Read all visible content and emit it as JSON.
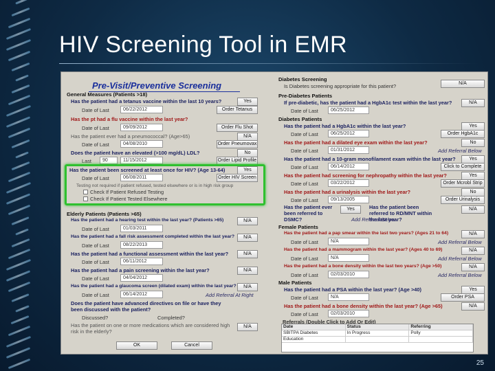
{
  "slide": {
    "title": "HIV Screening Tool in EMR",
    "number": "25"
  },
  "emr": {
    "panel_title": "Pre-Visit/Preventive Screening",
    "general": {
      "header": "General Measures (Patients >18)",
      "tetanus_q": "Has the patient had a tetanus vaccine within the last 10 years?",
      "tetanus_ans": "Yes",
      "date_of_last": "Date of Last",
      "tetanus_date": "06/22/2012",
      "order_tetanus": "Order Tetanus",
      "flu_q": "Has the pt had a flu vaccine within the last year?",
      "flu_date": "09/09/2012",
      "order_flu": "Order Flu Shot",
      "pneumo_q": "Has the patient ever had a pneumococcal? (Age>65)",
      "pneumo_ans": "N/A",
      "pneumo_date": "04/08/2010",
      "order_pneumovax": "Order Pneumovax",
      "ldl_q": "Does the patient have an elevated (>100 mg/dL) LDL?",
      "ldl_ans": "No",
      "ldl_last": "Last",
      "ldl_value": "90",
      "ldl_date": "11/15/2012",
      "order_lipid": "Order Lipid Profile",
      "hiv_q": "Has the patient been screened at least once for HIV? (Age 13-64)",
      "hiv_ans": "Yes",
      "hiv_date": "06/08/2011",
      "order_hiv": "Order HIV Screen",
      "hiv_note": "Testing not required if patient refused, tested elsewhere or is in high risk group",
      "check_refused": "Check If Patient Refused Testing",
      "check_elsewhere": "Check If Patient Tested Elsewhere"
    },
    "elderly": {
      "header": "Elderly Patients (Patients >65)",
      "hearing_q": "Has the patient had a hearing test within the last year? (Patients >65)",
      "hearing_ans": "N/A",
      "hearing_date": "01/03/2011",
      "fall_q": "Has the patient had a fall risk assessment completed within the last year?",
      "fall_ans": "N/A",
      "fall_date": "08/22/2013",
      "functional_q": "Has the patient had a functional assessment within the last year?",
      "functional_ans": "N/A",
      "functional_date": "06/11/2012",
      "pain_q": "Has the patient had a pain screening within the last year?",
      "pain_ans": "N/A",
      "pain_date": "04/04/2012",
      "glaucoma_q": "Has the patient had a glaucoma screen (dilated exam) within the last year?",
      "glaucoma_ans": "N/A",
      "glaucoma_date": "06/14/2012",
      "add_referral_right": "Add Referral At Right",
      "advance_q": "Does the patient have advanced directives on file or have they been discussed with the patient?",
      "discussed": "Discussed?",
      "completed": "Completed?",
      "meds_q": "Has the patient on one or more medications which are considered high risk in the elderly?",
      "meds_ans": "N/A",
      "ok": "OK",
      "cancel": "Cancel"
    },
    "diabetes_screening": {
      "header": "Diabetes Screening",
      "q": "Is Diabetes screening appropriate for this patient?",
      "ans": "N/A"
    },
    "prediabetes": {
      "header": "Pre-Diabetes Patients",
      "q": "If pre-diabetic, has the patient had a HgbA1c test within the last year?",
      "ans": "N/A",
      "date": "06/25/2012"
    },
    "diabetes": {
      "header": "Diabetes Patients",
      "a1c_q": "Has the patient had a HgbA1c within the last year?",
      "a1c_ans": "Yes",
      "a1c_date": "06/25/2012",
      "order_a1c": "Order HgbA1c",
      "eye_q": "Has the patient had a dilated eye exam within the last year?",
      "eye_ans": "No",
      "eye_date": "01/31/2012",
      "add_referral_below": "Add Referral Below",
      "mono_q": "Has the patient had a 10-gram monofilament exam within the last year?",
      "mono_ans": "Yes",
      "mono_date": "06/14/2012",
      "click_complete": "Click to Complete",
      "neph_q": "Has the patient had screening for nephropathy within the last year?",
      "neph_ans": "Yes",
      "neph_date": "03/22/2012",
      "order_strip": "Order Mcrobl Strip",
      "ua_q": "Has the patient had a urinalysis within the last year?",
      "ua_ans": "No",
      "ua_date": "09/13/2005",
      "order_ua": "Order Urinalysis",
      "dsmc_q": "Has the patient ever been referred to DSMC?",
      "dsmc_ans": "Yes",
      "rd_q": "Has the patient been referred to RD/MNT within the last year?",
      "rd_ans": "N/A",
      "add_referral_below2": "Add Referral Below"
    },
    "female": {
      "header": "Female Patients",
      "pap_q": "Has the patient had a pap smear within the last two years? (Ages 21 to 64)",
      "pap_ans": "N/A",
      "pap_date": "N/A",
      "add_referral_below": "Add Referral Below",
      "mammo_q": "Has the patient had a mammogram within the last year? (Ages 40 to 69)",
      "mammo_ans": "N/A",
      "mammo_date": "N/A",
      "add_referral_below2": "Add Referral Below",
      "bone_q": "Has the patient had a bone density within the last two years? (Age >50)",
      "bone_ans": "N/A",
      "bone_date": "02/03/2010",
      "add_referral_below3": "Add Referral Below"
    },
    "male": {
      "header": "Male Patients",
      "psa_q": "Has the patient had a PSA within the last year? (Age >40)",
      "psa_ans": "Yes",
      "psa_date": "N/A",
      "order_psa": "Order PSA",
      "bone_q": "Has the patient had a bone density within the last year? (Age >65)",
      "bone_ans": "N/A",
      "bone_date": "02/03/2010"
    },
    "referrals": {
      "caption": "Referrals (Double Click to Add Or Edit)",
      "headers": [
        "Date",
        "Status",
        "Referring"
      ],
      "rows": [
        [
          "SBITPA Diabetes",
          "In Progress",
          "Polly"
        ],
        [
          "Education",
          "",
          ""
        ]
      ]
    }
  }
}
